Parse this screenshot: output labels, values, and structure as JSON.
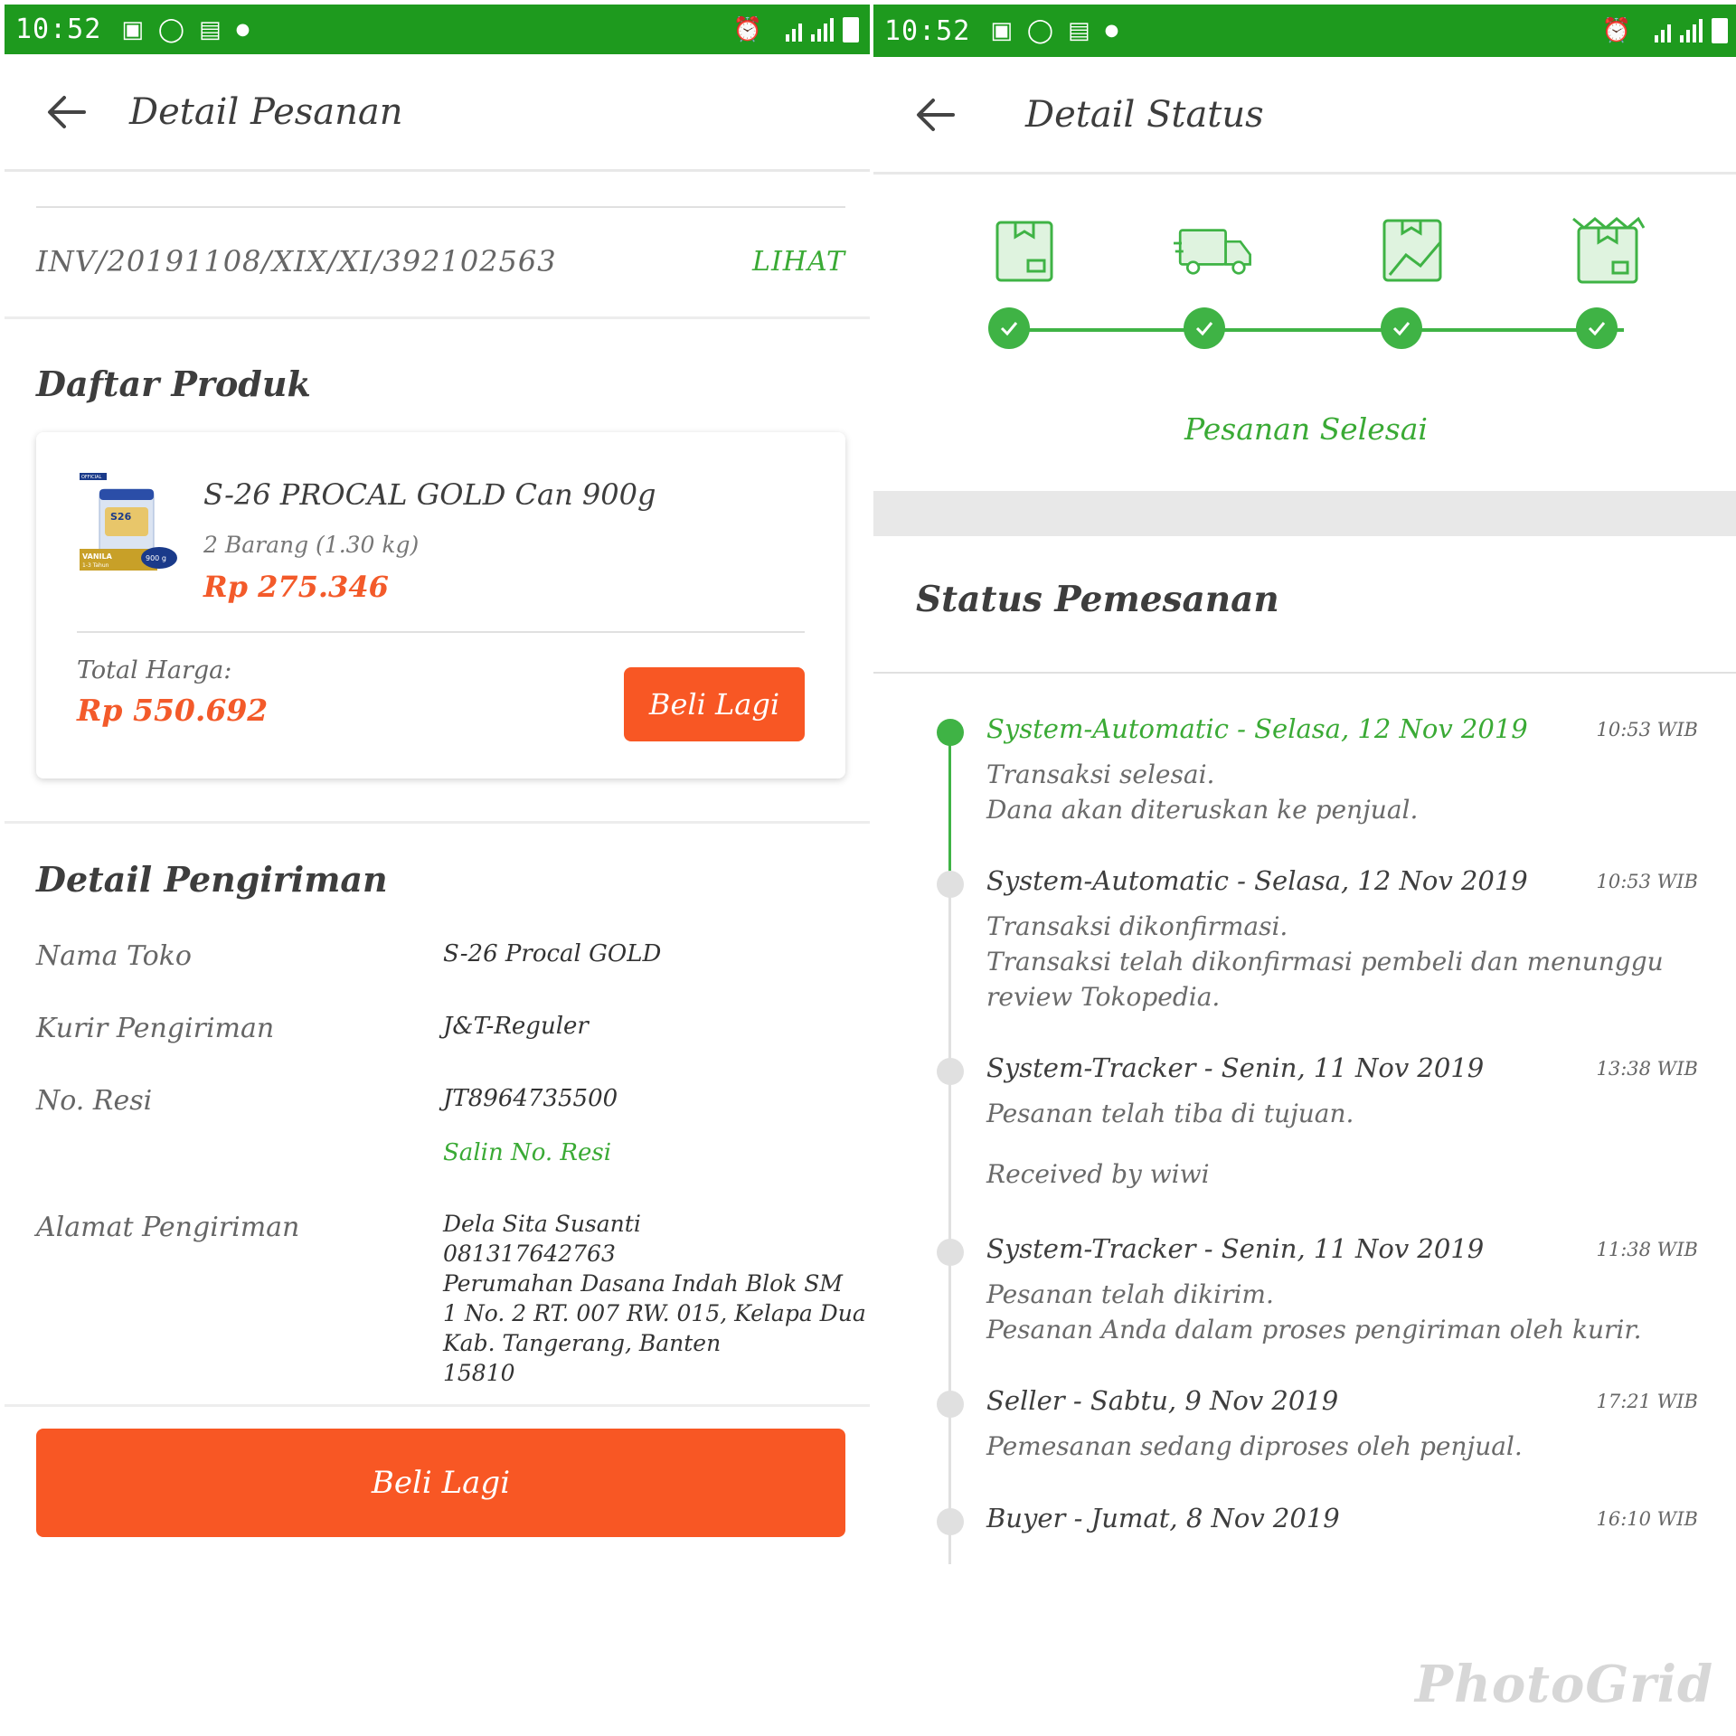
{
  "left": {
    "status_bar": {
      "time": "10:52"
    },
    "header": {
      "title": "Detail Pesanan"
    },
    "invoice": {
      "number": "INV/20191108/XIX/XI/392102563",
      "link": "LIHAT"
    },
    "products": {
      "title": "Daftar Produk",
      "item": {
        "name": "S-26 PROCAL GOLD Can 900g",
        "qty": "2 Barang (1.30 kg)",
        "price": "Rp 275.346"
      },
      "image_labels": {
        "official": "OFFICIAL",
        "brand": "S26",
        "variant": "VANILA",
        "age": "1-3 Tahun",
        "weight": "900 g"
      },
      "total_label": "Total Harga:",
      "total_value": "Rp 550.692",
      "buy_again": "Beli Lagi"
    },
    "shipping": {
      "title": "Detail Pengiriman",
      "rows": [
        {
          "label": "Nama Toko",
          "value": "S-26 Procal GOLD"
        },
        {
          "label": "Kurir Pengiriman",
          "value": "J&T-Reguler"
        },
        {
          "label": "No. Resi",
          "value": "JT8964735500"
        },
        {
          "label": "Alamat Pengiriman",
          "value": ""
        }
      ],
      "copy_receipt": "Salin No. Resi",
      "address_lines": [
        "Dela Sita Susanti",
        "081317642763",
        "Perumahan Dasana Indah Blok SM",
        "1 No. 2 RT. 007 RW. 015, Kelapa Dua",
        "Kab. Tangerang, Banten",
        "15810"
      ]
    },
    "bottom_button": "Beli Lagi"
  },
  "right": {
    "status_bar": {
      "time": "10:52"
    },
    "header": {
      "title": "Detail Status"
    },
    "progress": {
      "steps": [
        "order-received-icon",
        "delivery-truck-icon",
        "package-handover-icon",
        "order-complete-icon"
      ],
      "completed": 4,
      "label": "Pesanan Selesai"
    },
    "status_title": "Status Pemesanan",
    "timeline": [
      {
        "head": "System-Automatic - Selasa, 12 Nov 2019",
        "time": "10:53 WIB",
        "lines": [
          "Transaksi selesai.",
          "Dana akan diteruskan ke penjual."
        ]
      },
      {
        "head": "System-Automatic - Selasa, 12 Nov 2019",
        "time": "10:53 WIB",
        "lines": [
          "Transaksi dikonfirmasi.",
          "Transaksi telah dikonfirmasi pembeli dan menunggu review Tokopedia."
        ]
      },
      {
        "head": "System-Tracker - Senin, 11 Nov 2019",
        "time": "13:38 WIB",
        "lines": [
          "Pesanan telah tiba di tujuan."
        ],
        "extra": "Received by wiwi"
      },
      {
        "head": "System-Tracker - Senin, 11 Nov 2019",
        "time": "11:38 WIB",
        "lines": [
          "Pesanan telah dikirim.",
          "Pesanan Anda dalam proses pengiriman oleh kurir."
        ]
      },
      {
        "head": "Seller - Sabtu, 9 Nov 2019",
        "time": "17:21 WIB",
        "lines": [
          "Pemesanan sedang diproses oleh penjual."
        ]
      },
      {
        "head": "Buyer - Jumat, 8 Nov 2019",
        "time": "16:10 WIB",
        "lines": []
      }
    ]
  },
  "watermark": "PhotoGrid",
  "colors": {
    "status_bar": "#1e9a1e",
    "accent_green": "#3fb345",
    "accent_orange": "#f85724",
    "price_orange": "#f35a2a"
  }
}
